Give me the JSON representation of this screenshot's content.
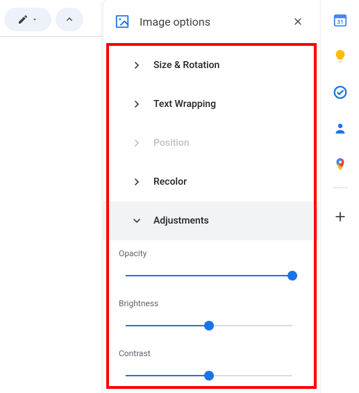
{
  "panel": {
    "title": "Image options",
    "sections": [
      {
        "label": "Size & Rotation",
        "expanded": false,
        "disabled": false
      },
      {
        "label": "Text Wrapping",
        "expanded": false,
        "disabled": false
      },
      {
        "label": "Position",
        "expanded": false,
        "disabled": true
      },
      {
        "label": "Recolor",
        "expanded": false,
        "disabled": false
      },
      {
        "label": "Adjustments",
        "expanded": true,
        "disabled": false
      }
    ],
    "adjustments": {
      "opacity": {
        "label": "Opacity",
        "value": 100
      },
      "brightness": {
        "label": "Brightness",
        "value": 50
      },
      "contrast": {
        "label": "Contrast",
        "value": 50
      }
    }
  },
  "sidepanel": {
    "items": [
      "calendar",
      "keep",
      "tasks",
      "contacts",
      "maps",
      "add"
    ]
  }
}
